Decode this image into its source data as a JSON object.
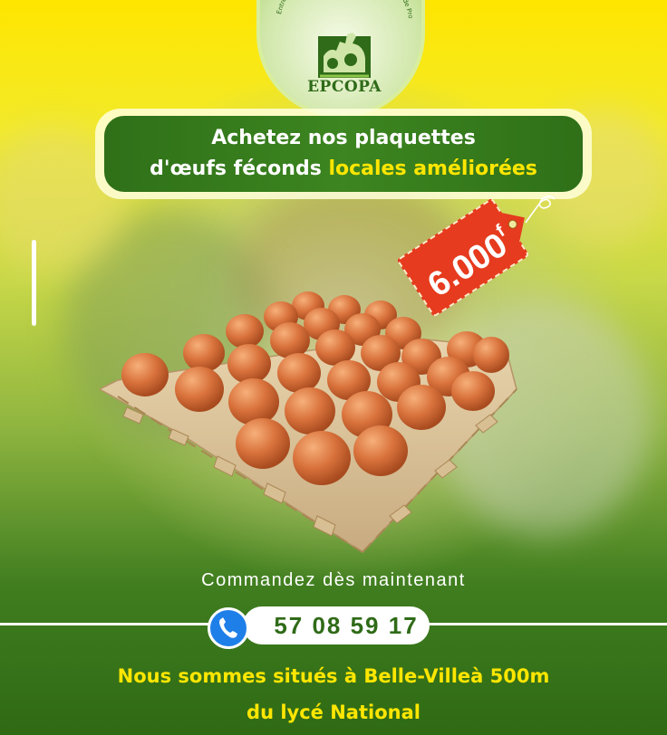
{
  "logo": {
    "name": "EPCOPA",
    "ring_text": "Entreprise de Production et de Commercialisation de Produit Agro-Pastoraux",
    "icon": "farm-animals-icon"
  },
  "headline": {
    "line1": "Achetez nos plaquettes",
    "line2_prefix": "d'œufs féconds ",
    "line2_highlight": "locales améliorées"
  },
  "price": {
    "amount": "6.000",
    "unit": "f"
  },
  "cta": "Commandez dès maintenant",
  "phone": {
    "number": "57 08 59 17",
    "icon": "phone-icon"
  },
  "address": {
    "line1": "Nous sommes situés à Belle-Villeà 500m",
    "line2": "du lycé National"
  },
  "colors": {
    "brand_green": "#2f6b18",
    "accent_yellow": "#ffe600",
    "price_red": "#e63b1e",
    "phone_blue": "#1f7fe8"
  }
}
